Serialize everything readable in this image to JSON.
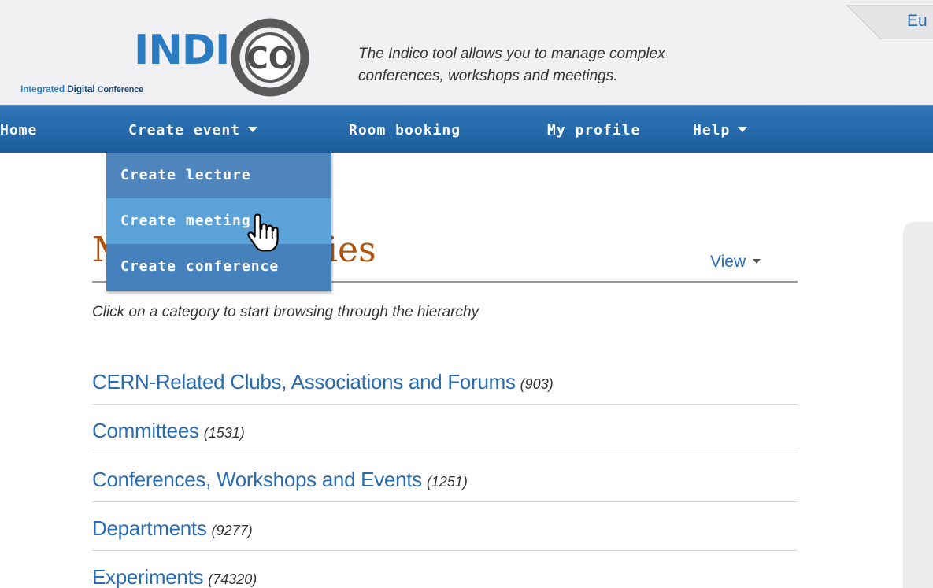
{
  "header": {
    "logo_main": "INDI",
    "logo_ring": "CO",
    "logo_sub_integrated": "Integrated",
    "logo_sub_digital": "Digital",
    "logo_sub_conference": "Conference",
    "tagline_line1": "The Indico tool allows you to manage complex",
    "tagline_line2": "conferences, workshops and meetings.",
    "language": "Eu"
  },
  "nav": {
    "items": [
      {
        "label": "Home"
      },
      {
        "label": "Create event",
        "has_menu": true
      },
      {
        "label": "Room booking"
      },
      {
        "label": "My profile"
      },
      {
        "label": "Help",
        "has_menu": true
      }
    ]
  },
  "dropdown": {
    "items": [
      {
        "label": "Create lecture"
      },
      {
        "label": "Create meeting",
        "hovered": true
      },
      {
        "label": "Create conference"
      }
    ]
  },
  "main": {
    "title": "Main categories",
    "view_label": "View",
    "hint": "Click on a category to start browsing through the hierarchy",
    "categories": [
      {
        "name": "CERN-Related Clubs, Associations and Forums",
        "count": "(903)"
      },
      {
        "name": "Committees",
        "count": "(1531)"
      },
      {
        "name": "Conferences, Workshops and Events",
        "count": "(1251)"
      },
      {
        "name": "Departments",
        "count": "(9277)"
      },
      {
        "name": "Experiments",
        "count": "(74320)"
      }
    ]
  },
  "colors": {
    "nav_bar": "#2f76b8",
    "menu_hover": "#5aa2d8",
    "link": "#2a6cb0",
    "title": "#b0530f"
  },
  "icons": {
    "cursor": "hand-pointer-icon",
    "dropdown": "caret-down-icon"
  }
}
